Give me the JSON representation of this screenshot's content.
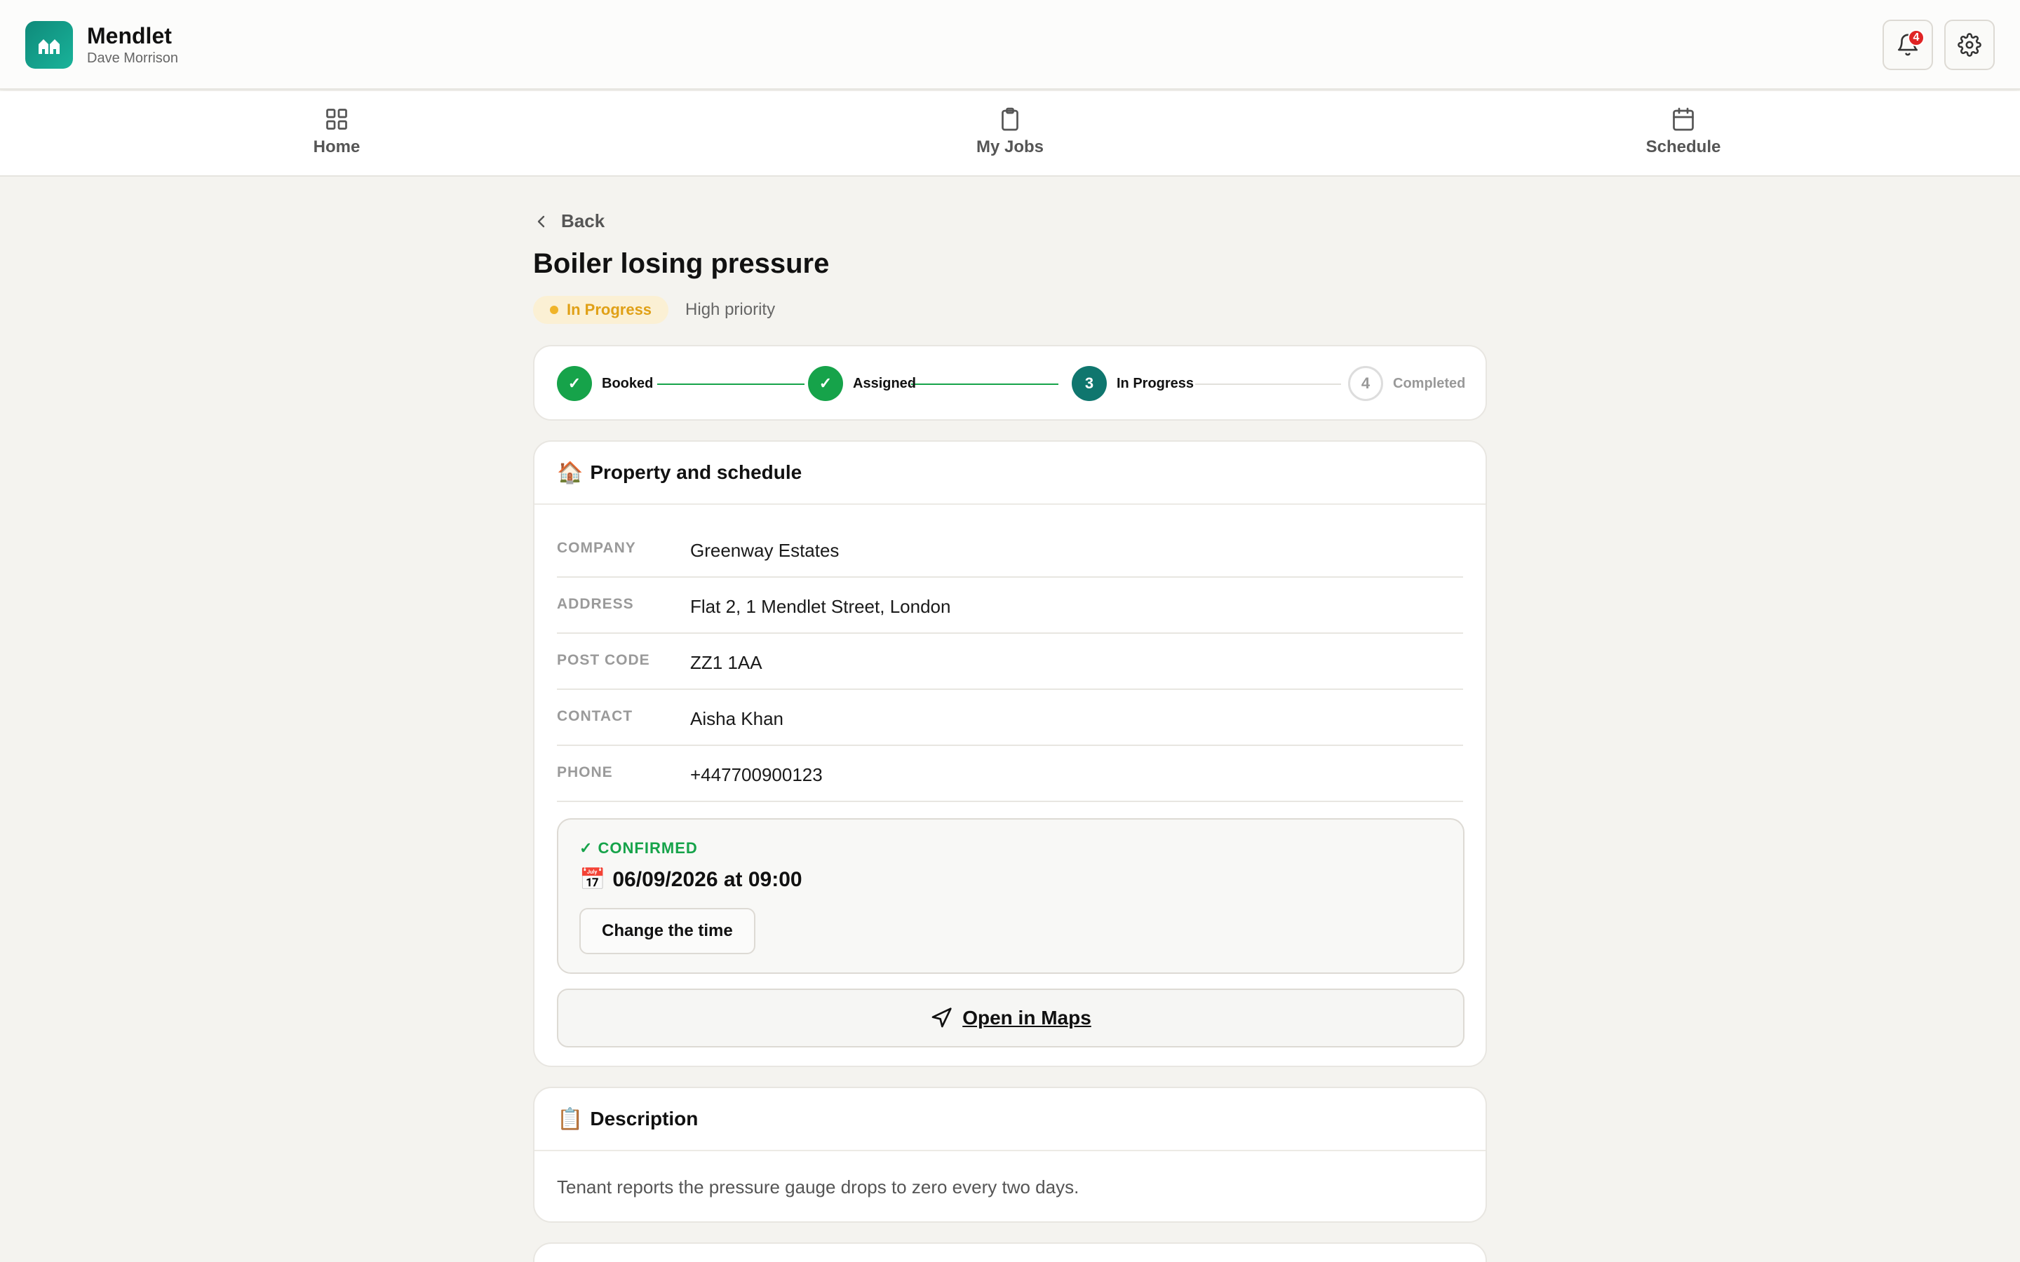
{
  "app": {
    "name": "Mendlet",
    "user": "Dave Morrison",
    "notification_count": "4"
  },
  "nav": [
    {
      "label": "Home",
      "icon": "grid-icon"
    },
    {
      "label": "My Jobs",
      "icon": "clipboard-icon"
    },
    {
      "label": "Schedule",
      "icon": "calendar-icon"
    }
  ],
  "back_label": "Back",
  "job": {
    "title": "Boiler losing pressure",
    "status": "In Progress",
    "priority": "High priority"
  },
  "stepper": [
    {
      "label": "Booked",
      "state": "done",
      "marker": "✓"
    },
    {
      "label": "Assigned",
      "state": "done",
      "marker": "✓"
    },
    {
      "label": "In Progress",
      "state": "current",
      "marker": "3"
    },
    {
      "label": "Completed",
      "state": "todo",
      "marker": "4"
    }
  ],
  "property": {
    "emoji": "🏠",
    "header": "Property and schedule",
    "rows": [
      {
        "key": "COMPANY",
        "value": "Greenway Estates"
      },
      {
        "key": "ADDRESS",
        "value": "Flat 2, 1 Mendlet Street, London"
      },
      {
        "key": "POST CODE",
        "value": "ZZ1 1AA"
      },
      {
        "key": "CONTACT",
        "value": "Aisha Khan"
      },
      {
        "key": "PHONE",
        "value": "+447700900123"
      }
    ],
    "confirm_label": "✓ CONFIRMED",
    "date_emoji": "📅",
    "date": "06/09/2026 at 09:00",
    "change_label": "Change the time",
    "maps_label": "Open in Maps"
  },
  "description": {
    "emoji": "📋",
    "header": "Description",
    "text": "Tenant reports the pressure gauge drops to zero every two days."
  },
  "colors": {
    "accent": "#0f766e",
    "done": "#16a34a",
    "warning": "#f0b429",
    "badge": "#e02424"
  }
}
